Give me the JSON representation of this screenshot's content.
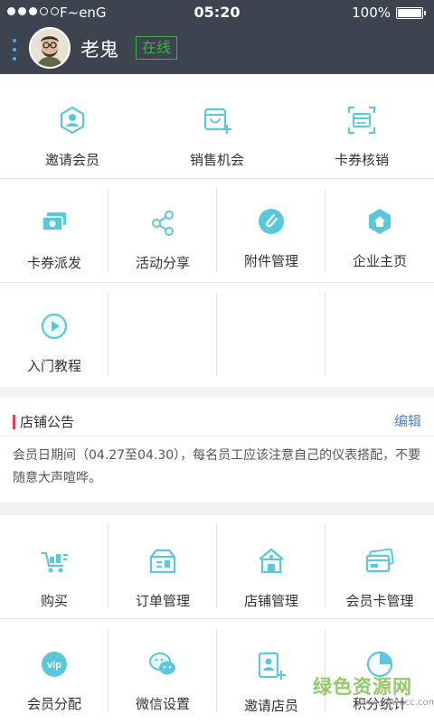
{
  "status_bar": {
    "carrier": "F~enG",
    "time": "05:20",
    "battery": "100%"
  },
  "header": {
    "username": "老鬼",
    "status": "在线"
  },
  "quick_row": [
    {
      "label": "邀请会员",
      "icon": "invite-member-icon"
    },
    {
      "label": "销售机会",
      "icon": "sales-opportunity-icon"
    },
    {
      "label": "卡券核销",
      "icon": "coupon-verify-icon"
    }
  ],
  "tools_row1": [
    {
      "label": "卡券派发",
      "icon": "coupon-distribute-icon"
    },
    {
      "label": "活动分享",
      "icon": "share-icon"
    },
    {
      "label": "附件管理",
      "icon": "attachment-icon"
    },
    {
      "label": "企业主页",
      "icon": "home-icon"
    }
  ],
  "tools_row2": [
    {
      "label": "入门教程",
      "icon": "play-icon"
    }
  ],
  "notice": {
    "title": "店铺公告",
    "edit": "编辑",
    "text": "会员日期间（04.27至04.30），每名员工应该注意自己的仪表搭配，不要随意大声喧哗。"
  },
  "manage_row1": [
    {
      "label": "购买",
      "icon": "cart-icon"
    },
    {
      "label": "订单管理",
      "icon": "order-icon"
    },
    {
      "label": "店铺管理",
      "icon": "store-icon"
    },
    {
      "label": "会员卡管理",
      "icon": "member-card-icon"
    }
  ],
  "manage_row2": [
    {
      "label": "会员分配",
      "icon": "vip-icon"
    },
    {
      "label": "微信设置",
      "icon": "wechat-icon"
    },
    {
      "label": "邀请店员",
      "icon": "invite-staff-icon"
    },
    {
      "label": "积分统计",
      "icon": "pie-chart-icon"
    }
  ],
  "watermark": {
    "logo": "绿色资源网",
    "url": "www.downcc.com"
  },
  "colors": {
    "header_bg": "#3d4450",
    "accent": "#5ac8dc",
    "online": "#39b34a",
    "notice_bar": "#e04050",
    "edit_link": "#4b88c8"
  }
}
